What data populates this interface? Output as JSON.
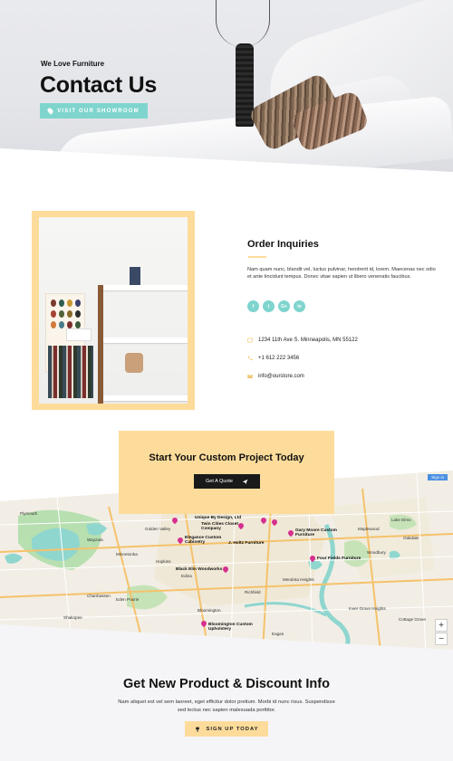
{
  "hero": {
    "eyebrow": "We Love Furniture",
    "title": "Contact Us",
    "button_label": "VISIT OUR SHOWROOM"
  },
  "order": {
    "title": "Order Inquiries",
    "body": "Nam quam nunc, blandit vel, luctus pulvinar, hendrerit id, lorem. Maecenas nec odio et ante tincidunt tempus. Donec vitae sapien ut libero venenatis faucibus.",
    "socials": [
      {
        "icon": "facebook-icon",
        "label": "f"
      },
      {
        "icon": "twitter-icon",
        "label": "t"
      },
      {
        "icon": "google-plus-icon",
        "label": "G+"
      },
      {
        "icon": "linkedin-icon",
        "label": "in"
      }
    ],
    "address": "1234 11th Ave S. Minneapolis, MN 55122",
    "phone": "+1 612 222 3456",
    "email": "info@ourstore.com"
  },
  "cta": {
    "title": "Start Your Custom Project Today",
    "button_label": "Get A Quote"
  },
  "map": {
    "signin": "Sign in",
    "zoom_in": "+",
    "zoom_out": "−",
    "pois": [
      "Unique By Design, Ltd",
      "Twin Cities Closet Company",
      "Gary Moore Custom Furniture",
      "Elegance Custom Cabinetry",
      "J. Holtz Furniture",
      "Four Fields Furniture",
      "Black Elm Woodworks",
      "Bloomington Custom Upholstery"
    ],
    "places": [
      "Plymouth",
      "Golden Valley",
      "Minnetonka",
      "Edina",
      "Eden Prairie",
      "Bloomington",
      "Richfield",
      "Eagan",
      "Woodbury",
      "Maplewood",
      "Roseville",
      "Lake Elmo",
      "Shoreview",
      "Oakdale",
      "Inver Grove Heights",
      "Shakopee",
      "Hopkins",
      "Wayzata",
      "Chanhassen",
      "Burnsville",
      "Cottage Grove",
      "Mendota Heights"
    ]
  },
  "newsletter": {
    "title": "Get New Product & Discount Info",
    "body": "Nam aliquet est vel sem laoreet, eget efficitur dolor pretium. Morbi id nunc risus. Suspendisse sed lectus nec sapien malesuada porttitor.",
    "button_label": "SIGN UP TODAY"
  },
  "colors": {
    "accent_teal": "#7fd5ce",
    "accent_yellow": "#fddc9b",
    "dark": "#1a1a1a",
    "map_pin": "#d6308f"
  }
}
